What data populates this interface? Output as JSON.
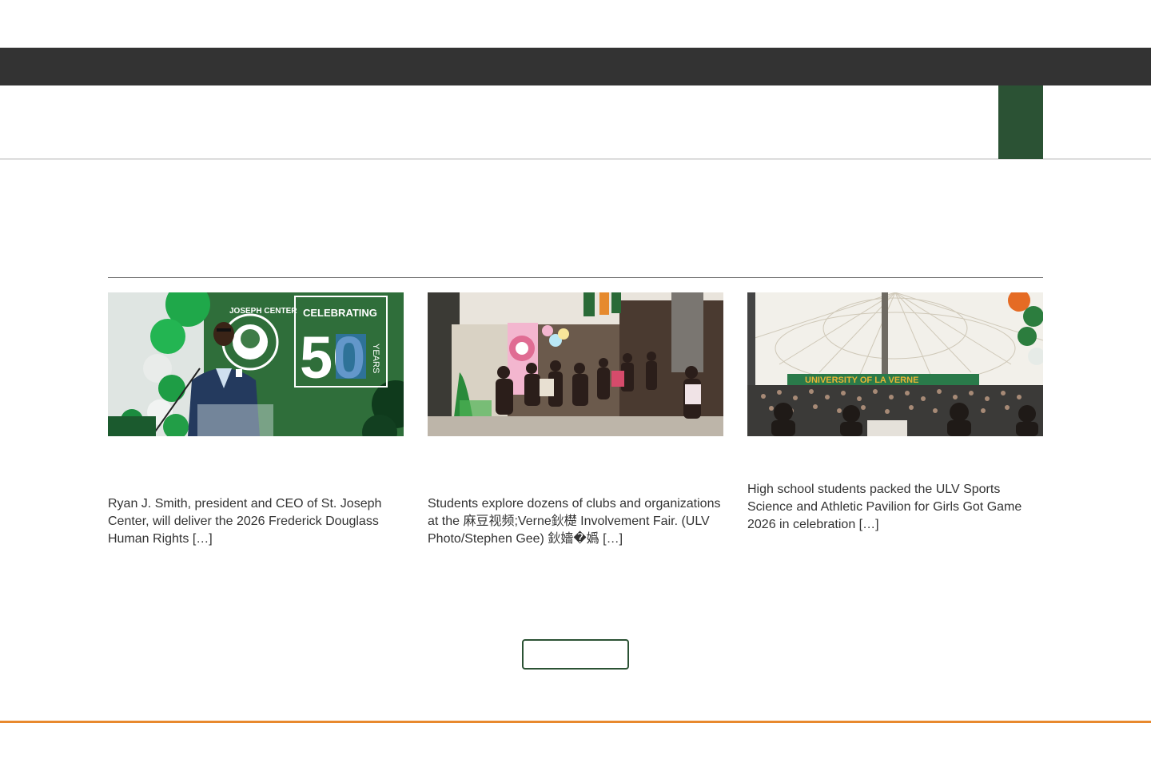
{
  "colors": {
    "brand_green": "#2b5234",
    "dark_bar": "#333333",
    "footer_orange": "#e8892e"
  },
  "news": {
    "items": [
      {
        "image_alt": "Speaker at podium in front of Joseph Center Celebrating 50 Years banner",
        "banner_text": {
          "line1": "JOSEPH CENTER",
          "line2": "CELEBRATING",
          "number": "50",
          "side": "YEARS"
        },
        "excerpt": "Ryan J. Smith, president and CEO of St. Joseph Center, will deliver the 2026 Frederick Douglass Human Rights […]"
      },
      {
        "image_alt": "Students crowding a hallway at the involvement fair",
        "excerpt": "Students explore dozens of clubs and organizations at the 麻豆视频;Verne鈥檚 Involvement Fair. (ULV Photo/Stephen Gee) 鈥嬙�嬀 […]"
      },
      {
        "image_alt": "Crowd of high school students in the ULV Sports Science and Athletic Pavilion",
        "banner_text": {
          "line1": "UNIVERSITY OF LA VERNE"
        },
        "excerpt": "High school students packed the ULV Sports Science and Athletic Pavilion for Girls Got Game 2026 in celebration […]"
      }
    ]
  },
  "more_button_label": ""
}
